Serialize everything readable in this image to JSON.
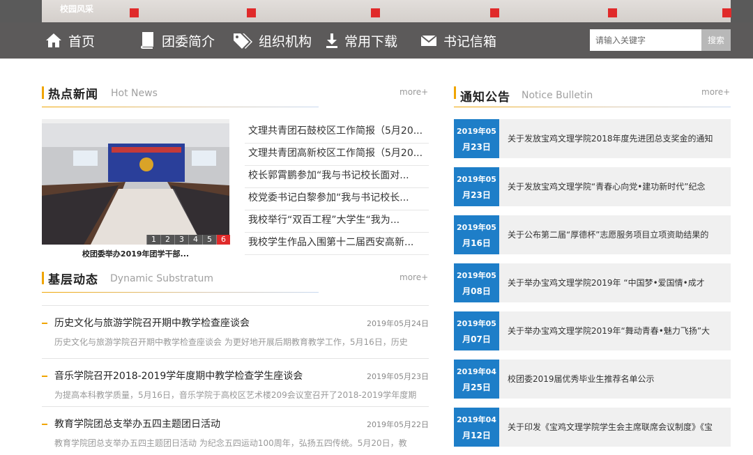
{
  "banner": {
    "caption": "校园风采"
  },
  "nav": {
    "items": [
      {
        "label": "首页",
        "icon": "home-icon"
      },
      {
        "label": "团委简介",
        "icon": "book-icon"
      },
      {
        "label": "组织机构",
        "icon": "tags-icon"
      },
      {
        "label": "常用下载",
        "icon": "download-icon"
      },
      {
        "label": "书记信箱",
        "icon": "envelope-icon"
      }
    ],
    "search_placeholder": "请输入关键字",
    "search_button": "搜索"
  },
  "hot_news": {
    "title_cn": "热点新闻",
    "title_en": "Hot News",
    "more": "more+",
    "slide_caption": "校团委举办2019年团学干部...",
    "pager": [
      "1",
      "2",
      "3",
      "4",
      "5",
      "6"
    ],
    "active_page": "6",
    "items": [
      "文理共青团石鼓校区工作简报（5月20...",
      "文理共青团高新校区工作简报（5月20...",
      "校长郭霄鹏参加“我与书记校长面对...",
      "校党委书记白黎参加“我与书记校长...",
      "我校举行“双百工程”大学生“我为...",
      "我校学生作品入围第十二届西安高新..."
    ]
  },
  "dynamic": {
    "title_cn": "基层动态",
    "title_en": "Dynamic Substratum",
    "more": "more+",
    "items": [
      {
        "title": "历史文化与旅游学院召开期中教学检查座谈会",
        "date": "2019年05月24日",
        "summary": "历史文化与旅游学院召开期中教学检查座谈会 为更好地开展后期教育教学工作，5月16日，历史"
      },
      {
        "title": "音乐学院召开2018-2019学年度期中教学检查学生座谈会",
        "date": "2019年05月23日",
        "summary": "为提高本科教学质量，5月16日，音乐学院于高校区艺术楼209会议室召开了2018-2019学年度期"
      },
      {
        "title": "教育学院团总支举办五四主题团日活动",
        "date": "2019年05月22日",
        "summary": "教育学院团总支举办五四主题团日活动 为纪念五四运动100周年，弘扬五四传统。5月20日，教"
      }
    ]
  },
  "notices": {
    "title_cn": "通知公告",
    "title_en": "Notice Bulletin",
    "more": "more+",
    "items": [
      {
        "ym": "2019年05",
        "dd": "月23日",
        "text": "关于发放宝鸡文理学院2018年度先进团总支奖金的通知"
      },
      {
        "ym": "2019年05",
        "dd": "月23日",
        "text": "关于发放宝鸡文理学院“青春心向党•建功新时代”纪念"
      },
      {
        "ym": "2019年05",
        "dd": "月16日",
        "text": "关于公布第二届“厚德杯”志愿服务项目立项资助结果的"
      },
      {
        "ym": "2019年05",
        "dd": "月08日",
        "text": "关于举办宝鸡文理学院2019年 “中国梦•爱国情•成才"
      },
      {
        "ym": "2019年05",
        "dd": "月07日",
        "text": "关于举办宝鸡文理学院2019年“舞动青春•魅力飞扬”大"
      },
      {
        "ym": "2019年04",
        "dd": "月25日",
        "text": "校团委2019届优秀毕业生推荐名单公示"
      },
      {
        "ym": "2019年04",
        "dd": "月12日",
        "text": "关于印发《宝鸡文理学院学生会主席联席会议制度》《宝"
      }
    ]
  },
  "colors": {
    "accent": "#f0a500",
    "nav_bg": "#5c5a5a",
    "date_blue": "#1e7ec8",
    "active_red": "#e02a2a"
  }
}
